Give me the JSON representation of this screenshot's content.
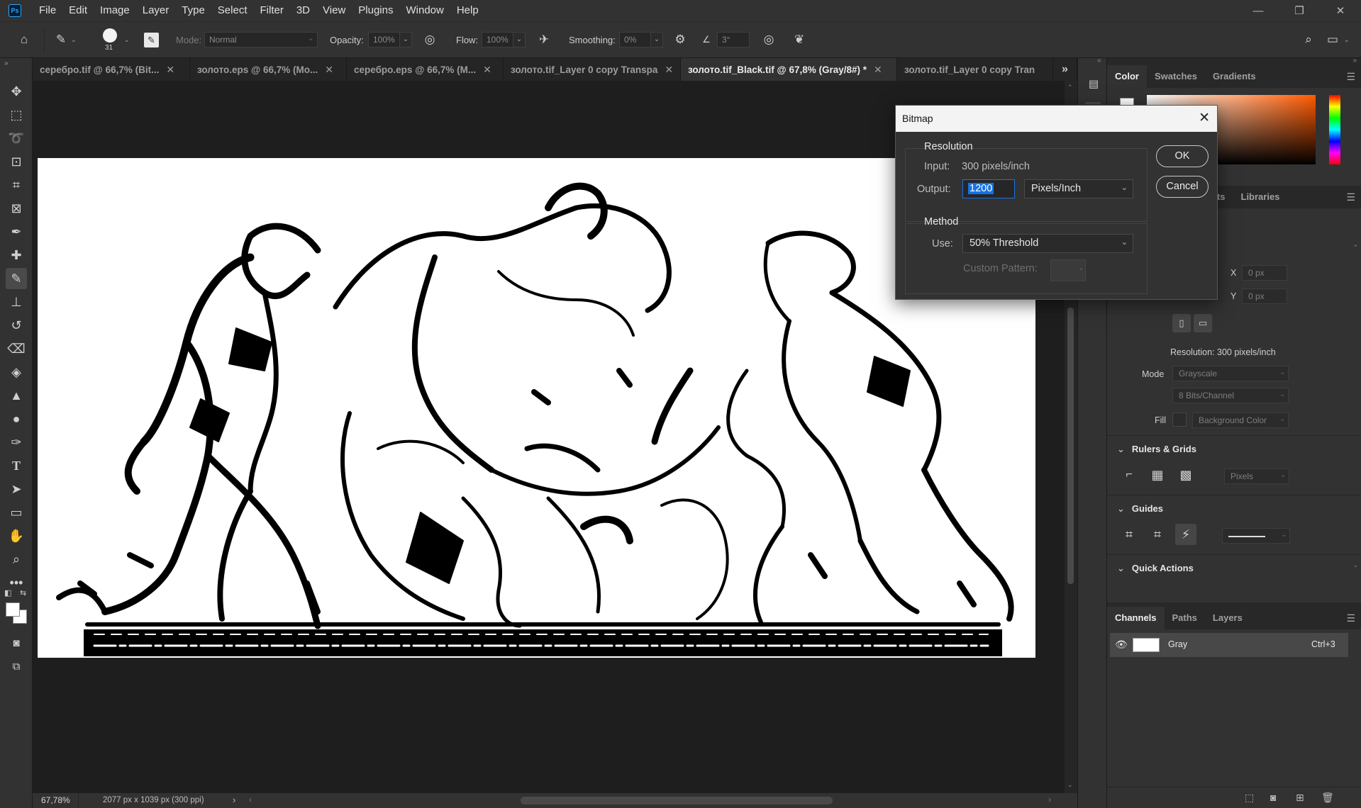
{
  "app": {
    "logo": "Ps"
  },
  "menu": [
    "File",
    "Edit",
    "Image",
    "Layer",
    "Type",
    "Select",
    "Filter",
    "3D",
    "View",
    "Plugins",
    "Window",
    "Help"
  ],
  "window_controls": {
    "minimize": "—",
    "restore": "❐",
    "close": "✕"
  },
  "options": {
    "brush_size": "31",
    "mode_label": "Mode:",
    "mode_value": "Normal",
    "opacity_label": "Opacity:",
    "opacity_value": "100%",
    "flow_label": "Flow:",
    "flow_value": "100%",
    "smoothing_label": "Smoothing:",
    "smoothing_value": "0%",
    "angle_value": "3°"
  },
  "tabs": [
    {
      "label": "серебро.tif @ 66,7% (Bit...",
      "active": false
    },
    {
      "label": "золото.eps @ 66,7% (Mo...",
      "active": false
    },
    {
      "label": "серебро.eps @ 66,7% (M...",
      "active": false
    },
    {
      "label": "золото.tif_Layer 0 copy Transpa",
      "active": false
    },
    {
      "label": "золото.tif_Black.tif @ 67,8% (Gray/8#) *",
      "active": true
    },
    {
      "label": "золото.tif_Layer 0 copy Tran",
      "active": false
    }
  ],
  "tab_overflow": "»",
  "status": {
    "zoom": "67,78%",
    "doc_info": "2077 px x 1039 px (300 ppi)",
    "arrow": "›"
  },
  "color_panel": {
    "tabs": [
      "Color",
      "Swatches",
      "Gradients"
    ],
    "active": "Color"
  },
  "props_panel": {
    "tabs_partial": [
      "nts",
      "Libraries"
    ],
    "x_label": "X",
    "x_value": "0 px",
    "y_label": "Y",
    "y_value": "0 px",
    "resolution": "Resolution: 300 pixels/inch",
    "mode_label": "Mode",
    "mode_value": "Grayscale",
    "bits_value": "8 Bits/Channel",
    "fill_label": "Fill",
    "fill_value": "Background Color",
    "rulers_title": "Rulers & Grids",
    "rulers_unit": "Pixels",
    "guides_title": "Guides",
    "quick_actions_title": "Quick Actions"
  },
  "channels_panel": {
    "tabs": [
      "Channels",
      "Paths",
      "Layers"
    ],
    "active": "Channels",
    "rows": [
      {
        "name": "Gray",
        "shortcut": "Ctrl+3"
      }
    ]
  },
  "dialog": {
    "title": "Bitmap",
    "close": "✕",
    "resolution_group": "Resolution",
    "input_label": "Input:",
    "input_value": "300 pixels/inch",
    "output_label": "Output:",
    "output_value": "1200",
    "output_unit": "Pixels/Inch",
    "method_group": "Method",
    "use_label": "Use:",
    "use_value": "50% Threshold",
    "custom_pattern_label": "Custom Pattern:",
    "ok": "OK",
    "cancel": "Cancel"
  },
  "colors": {
    "accent": "#1473e6",
    "bg": "#323232",
    "canvas": "#1e1e1e"
  }
}
